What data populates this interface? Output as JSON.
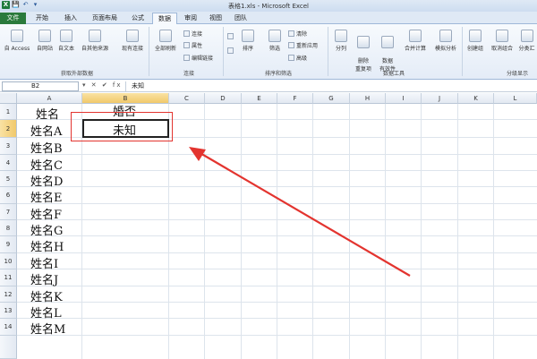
{
  "window": {
    "title": "表格1.xls - Microsoft Excel",
    "qat": [
      "X",
      "💾",
      "↶",
      "▾"
    ]
  },
  "tabs": [
    {
      "label": "文件"
    },
    {
      "label": "开始"
    },
    {
      "label": "插入"
    },
    {
      "label": "页面布局"
    },
    {
      "label": "公式"
    },
    {
      "label": "数据"
    },
    {
      "label": "审阅"
    },
    {
      "label": "视图"
    },
    {
      "label": "团队"
    }
  ],
  "ribbon": {
    "external": {
      "buttons": [
        "自 Access",
        "自网站",
        "自文本",
        "自其他来源",
        "现有连接"
      ],
      "label": "获取外部数据"
    },
    "connections": {
      "refresh": "全部刷新",
      "small": [
        "连接",
        "属性",
        "编辑链接"
      ],
      "label": "连接"
    },
    "sort": {
      "sort_btn": "排序",
      "filter_btn": "筛选",
      "small": [
        "清除",
        "重新应用",
        "高级"
      ],
      "label": "排序和筛选"
    },
    "tools": {
      "buttons": [
        "分列",
        "删除\n重复项",
        "数据\n有效性",
        "合并计算",
        "模拟分析"
      ],
      "label": "数据工具"
    },
    "outline": {
      "buttons": [
        "创建组",
        "取消组合",
        "分类汇"
      ],
      "label": "分级显示"
    }
  },
  "formula_bar": {
    "name_box": "B2",
    "icons": "▾ ✕ ✔ fx",
    "value": "未知"
  },
  "sheet": {
    "columns": [
      "A",
      "B",
      "C",
      "D",
      "E",
      "F",
      "G",
      "H",
      "I",
      "J",
      "K",
      "L"
    ],
    "rows": [
      "1",
      "2",
      "3",
      "4",
      "5",
      "6",
      "7",
      "8",
      "9",
      "10",
      "11",
      "12",
      "13",
      "14"
    ],
    "colA": [
      "姓名",
      "姓名A",
      "姓名B",
      "姓名C",
      "姓名D",
      "姓名E",
      "姓名F",
      "姓名G",
      "姓名H",
      "姓名I",
      "姓名J",
      "姓名K",
      "姓名L",
      "姓名M"
    ],
    "b1": "婚否",
    "b2": "未知"
  },
  "colors": {
    "accent_red": "#e3342f",
    "file_tab": "#2a7a3c",
    "selected_header": "#f1c96b"
  }
}
